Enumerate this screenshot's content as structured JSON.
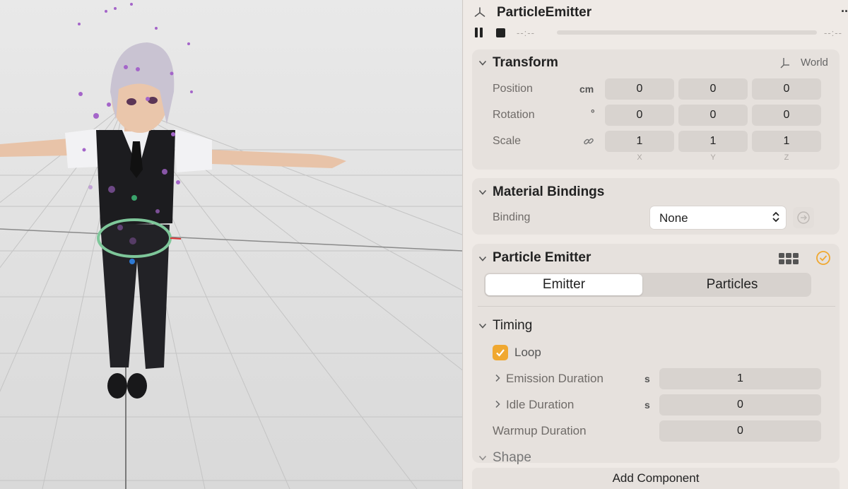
{
  "inspector": {
    "title": "ParticleEmitter",
    "more_label": "··",
    "time_left": "--:--",
    "time_right": "--:--",
    "colors": {
      "accent": "#f0a830",
      "panel": "#efeae6",
      "card": "#e6e1dd"
    }
  },
  "transform": {
    "title": "Transform",
    "space_label": "World",
    "rows": [
      {
        "label": "Position",
        "unit": "cm",
        "x": "0",
        "y": "0",
        "z": "0"
      },
      {
        "label": "Rotation",
        "unit": "°",
        "x": "0",
        "y": "0",
        "z": "0"
      },
      {
        "label": "Scale",
        "unit_icon": "link-icon",
        "x": "1",
        "y": "1",
        "z": "1"
      }
    ],
    "axes": [
      "X",
      "Y",
      "Z"
    ]
  },
  "material_bindings": {
    "title": "Material Bindings",
    "binding_label": "Binding",
    "binding_value": "None"
  },
  "particle_emitter": {
    "title": "Particle Emitter",
    "tabs": [
      "Emitter",
      "Particles"
    ],
    "active_tab": "Emitter",
    "timing": {
      "title": "Timing",
      "loop_label": "Loop",
      "loop_checked": true,
      "emission_duration_label": "Emission Duration",
      "emission_duration_unit": "s",
      "emission_duration_value": "1",
      "idle_duration_label": "Idle Duration",
      "idle_duration_unit": "s",
      "idle_duration_value": "0",
      "warmup_duration_label": "Warmup Duration",
      "warmup_duration_value": "0"
    },
    "shape_title": "Shape"
  },
  "footer": {
    "add_component_label": "Add Component"
  }
}
